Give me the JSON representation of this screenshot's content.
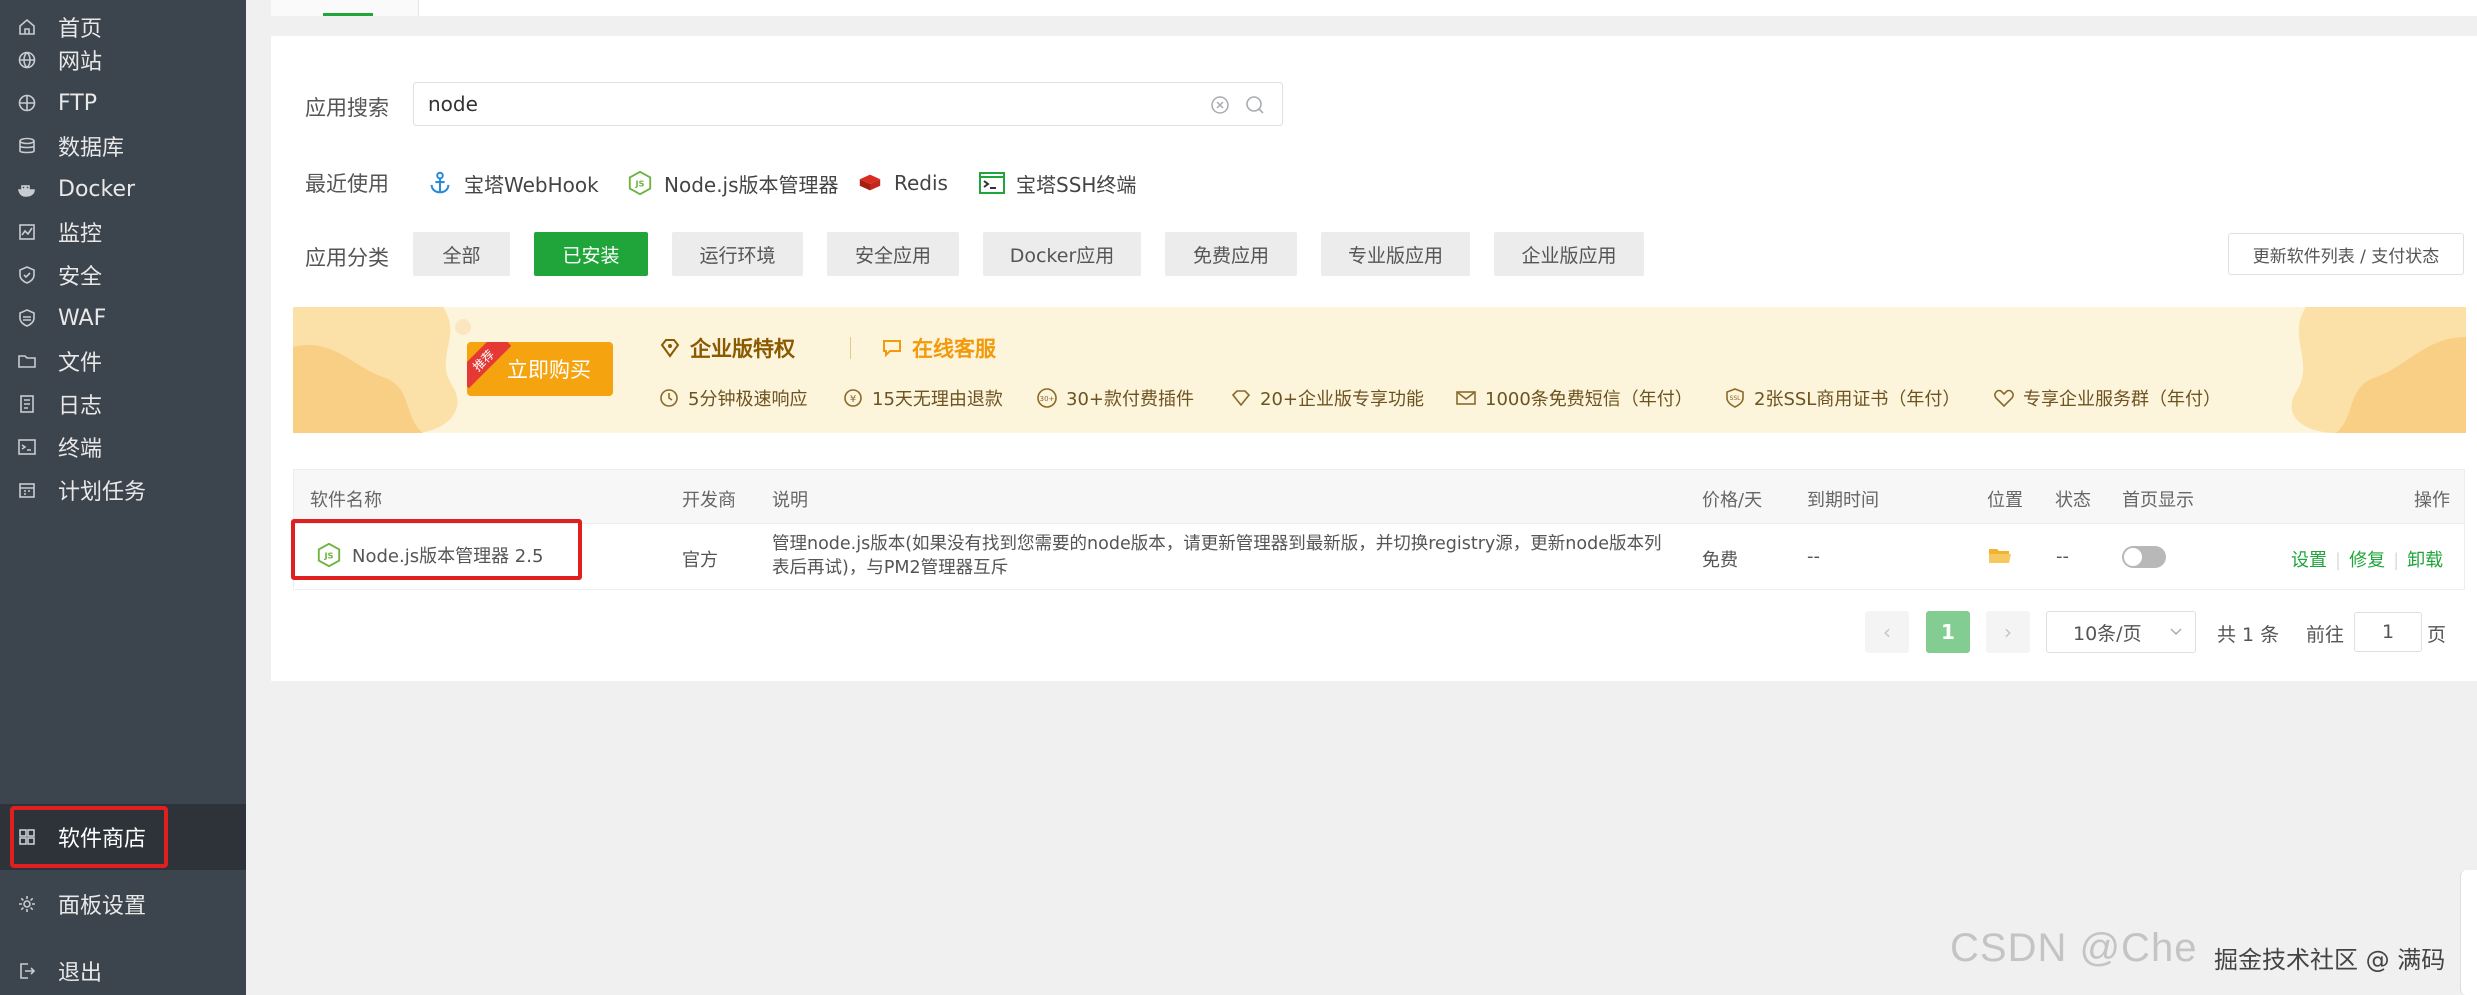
{
  "sidebar": {
    "items": [
      {
        "label": "首页",
        "icon": "home-icon"
      },
      {
        "label": "网站",
        "icon": "globe-icon"
      },
      {
        "label": "FTP",
        "icon": "ftp-icon"
      },
      {
        "label": "数据库",
        "icon": "database-icon"
      },
      {
        "label": "Docker",
        "icon": "docker-icon"
      },
      {
        "label": "监控",
        "icon": "monitor-icon"
      },
      {
        "label": "安全",
        "icon": "shield-icon"
      },
      {
        "label": "WAF",
        "icon": "waf-icon"
      },
      {
        "label": "文件",
        "icon": "folder-icon"
      },
      {
        "label": "日志",
        "icon": "log-icon"
      },
      {
        "label": "终端",
        "icon": "terminal-icon"
      },
      {
        "label": "计划任务",
        "icon": "calendar-icon"
      },
      {
        "label": "软件商店",
        "icon": "grid-icon",
        "active": true
      },
      {
        "label": "面板设置",
        "icon": "gear-icon"
      },
      {
        "label": "退出",
        "icon": "logout-icon"
      }
    ]
  },
  "search": {
    "label": "应用搜索",
    "value": "node"
  },
  "recent": {
    "label": "最近使用",
    "items": [
      {
        "label": "宝塔WebHook",
        "icon": "anchor-icon"
      },
      {
        "label": "Node.js版本管理器",
        "icon": "nodejs-icon"
      },
      {
        "label": "Redis",
        "icon": "redis-icon"
      },
      {
        "label": "宝塔SSH终端",
        "icon": "terminal-icon"
      }
    ]
  },
  "categories": {
    "label": "应用分类",
    "items": [
      "全部",
      "已安装",
      "运行环境",
      "安全应用",
      "Docker应用",
      "免费应用",
      "专业版应用",
      "企业版应用"
    ],
    "active": "已安装",
    "update_button": "更新软件列表 / 支付状态"
  },
  "banner": {
    "buy_label": "立即购买",
    "ribbon": "推荐",
    "title": "企业版特权",
    "service": "在线客服",
    "features": [
      "5分钟极速响应",
      "15天无理由退款",
      "30+款付费插件",
      "20+企业版专享功能",
      "1000条免费短信（年付）",
      "2张SSL商用证书（年付）",
      "专享企业服务群（年付）"
    ]
  },
  "table": {
    "headers": [
      "软件名称",
      "开发商",
      "说明",
      "价格/天",
      "到期时间",
      "位置",
      "状态",
      "首页显示",
      "操作"
    ],
    "rows": [
      {
        "name": "Node.js版本管理器 2.5",
        "vendor": "官方",
        "description": "管理node.js版本(如果没有找到您需要的node版本，请更新管理器到最新版，并切换registry源，更新node版本列表后再试)，与PM2管理器互斥",
        "price": "免费",
        "expire": "--",
        "status": "--",
        "home_display": false,
        "actions": [
          "设置",
          "修复",
          "卸载"
        ]
      }
    ]
  },
  "pagination": {
    "current_page": "1",
    "page_size": "10条/页",
    "total": "共 1 条",
    "goto_label": "前往",
    "goto_value": "1",
    "page_unit": "页"
  },
  "watermark": "CSDN @Che",
  "watermark2": "掘金技术社区 @ 满码",
  "colors": {
    "sidebar_bg": "#3c444d",
    "accent": "#20a53a",
    "banner_bg": "#fdf4dc",
    "highlight": "#e02020"
  }
}
